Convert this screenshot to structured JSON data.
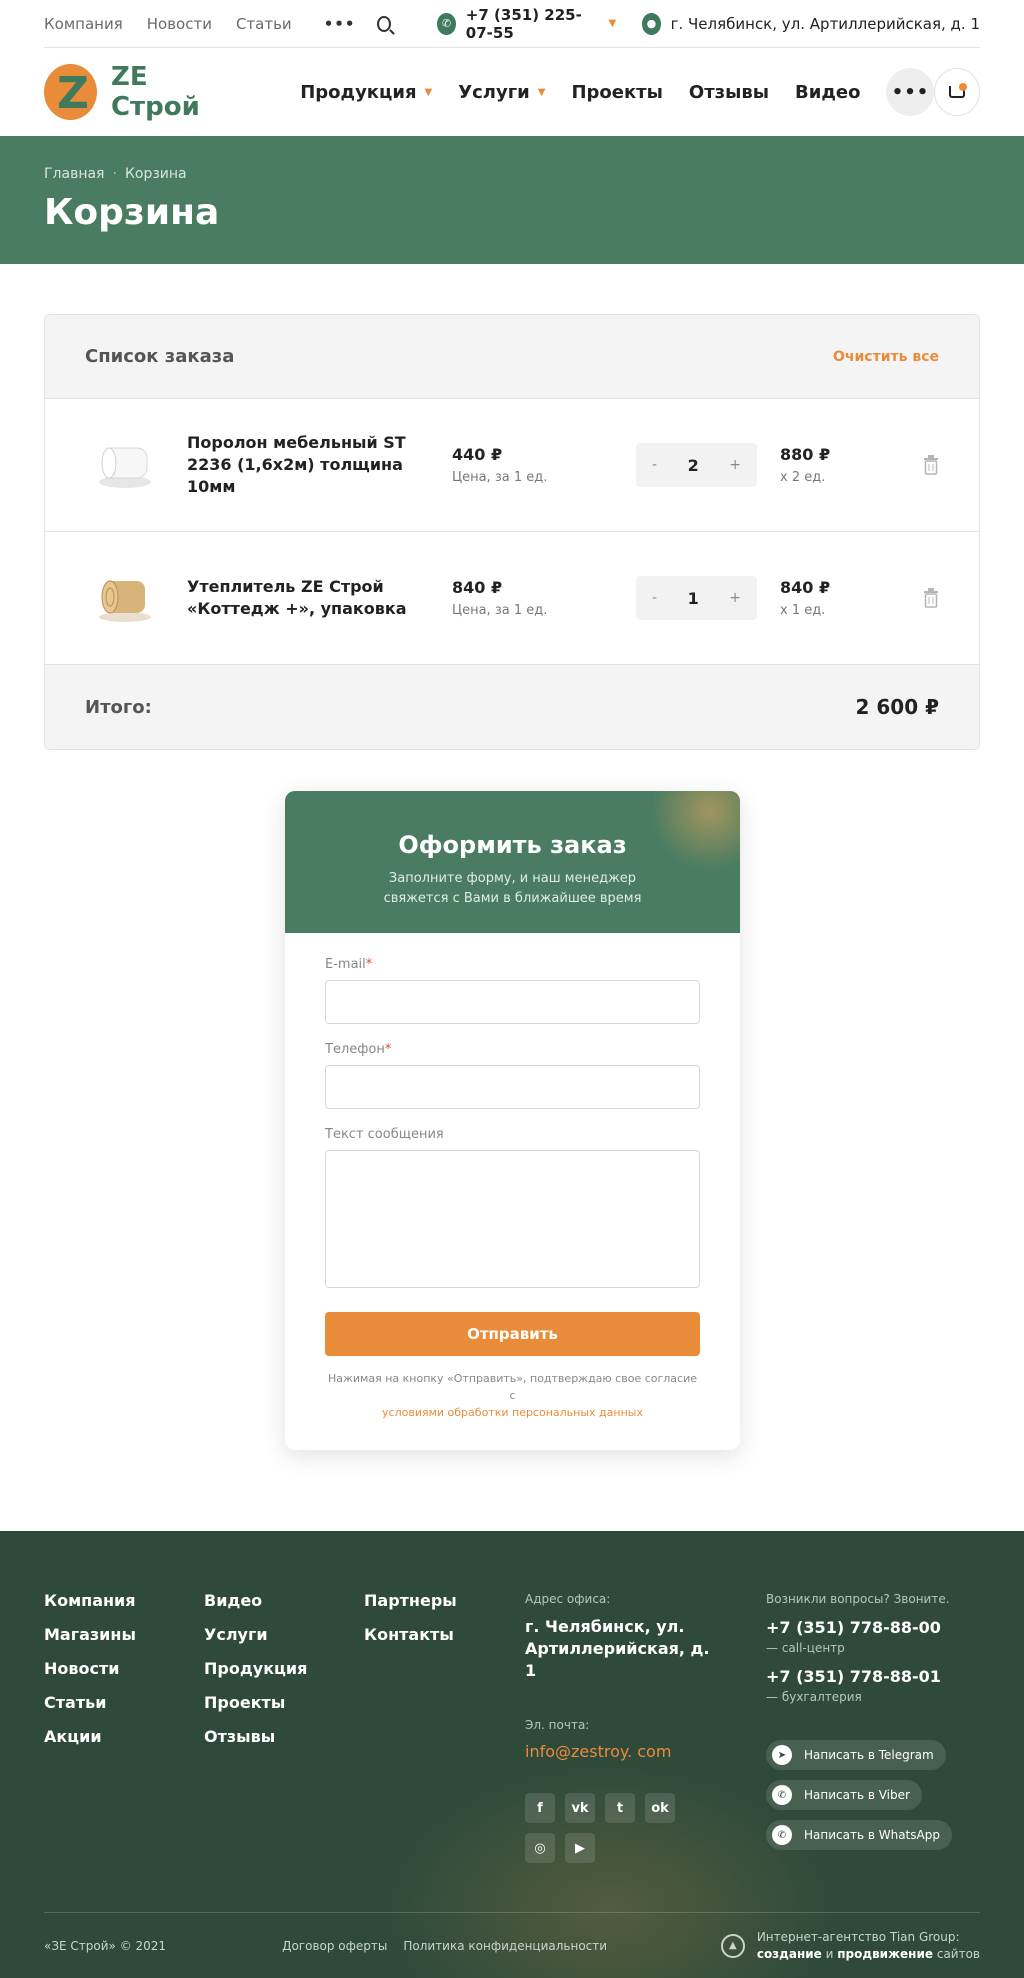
{
  "topbar": {
    "links": [
      "Компания",
      "Новости",
      "Статьи"
    ],
    "more": "•••",
    "phone": "+7 (351) 225-07-55",
    "address": "г. Челябинск, ул. Артиллерийская, д. 1"
  },
  "header": {
    "logo_letter": "Z",
    "logo_text": "ZE Строй",
    "nav": [
      {
        "label": "Продукция",
        "has_caret": true
      },
      {
        "label": "Услуги",
        "has_caret": true
      },
      {
        "label": "Проекты",
        "has_caret": false
      },
      {
        "label": "Отзывы",
        "has_caret": false
      },
      {
        "label": "Видео",
        "has_caret": false
      }
    ],
    "more": "•••"
  },
  "hero": {
    "breadcrumbs": [
      "Главная",
      "Корзина"
    ],
    "title": "Корзина"
  },
  "cart": {
    "title": "Список заказа",
    "clear_label": "Очистить все",
    "items": [
      {
        "name": "Поролон мебельный ST 2236 (1,6х2м) толщина 10мм",
        "price": "440 ₽",
        "price_note": "Цена, за 1 ед.",
        "qty": "2",
        "sum": "880 ₽",
        "sum_note": "x 2 ед.",
        "minus": "-",
        "plus": "+"
      },
      {
        "name": "Утеплитель ZE Строй «Коттедж +», упаковка",
        "price": "840 ₽",
        "price_note": "Цена, за 1 ед.",
        "qty": "1",
        "sum": "840 ₽",
        "sum_note": "x 1 ед.",
        "minus": "-",
        "plus": "+"
      }
    ],
    "total_label": "Итого:",
    "total_value": "2 600 ₽"
  },
  "order_form": {
    "title": "Оформить заказ",
    "subtitle_line1": "Заполните форму, и наш менеджер",
    "subtitle_line2": "свяжется с Вами в ближайшее время",
    "email_label": "E-mail",
    "phone_label": "Телефон",
    "message_label": "Текст сообщения",
    "required_mark": "*",
    "submit_label": "Отправить",
    "agree_text": "Нажимая на кнопку «Отправить», подтверждаю свое согласие с",
    "agree_link": "условиями обработки персональных данных"
  },
  "footer": {
    "col1": [
      "Компания",
      "Магазины",
      "Новости",
      "Статьи",
      "Акции"
    ],
    "col2": [
      "Видео",
      "Услуги",
      "Продукция",
      "Проекты",
      "Отзывы"
    ],
    "col3": [
      "Партнеры",
      "Контакты"
    ],
    "address_caption": "Адрес офиса:",
    "address_line1": "г. Челябинск, ул.",
    "address_line2": "Артиллерийская, д. 1",
    "email_caption": "Эл. почта:",
    "email": "info@zestroy. com",
    "socials": [
      "f",
      "vk",
      "tw",
      "ok",
      "ig",
      "yt"
    ],
    "call_caption": "Возникли вопросы? Звоните.",
    "phone1": "+7 (351) 778-88-00",
    "phone1_note": "— call-центр",
    "phone2": "+7 (351) 778-88-01",
    "phone2_note": "— бухгалтерия",
    "messengers": [
      "Написать в Telegram",
      "Написать в Viber",
      "Написать в WhatsApp"
    ],
    "copyright": "«ЗЕ Строй» © 2021",
    "offer": "Договор оферты",
    "privacy": "Политика конфиденциальности",
    "agency_line1": "Интернет-агентство Tian Group:",
    "agency_w1": "создание",
    "agency_w2": "и",
    "agency_w3": "продвижение",
    "agency_w4": "сайтов"
  },
  "colors": {
    "accent": "#e98c3a",
    "brand_green": "#4a7c62",
    "footer_bg": "#2f4a3a"
  },
  "icons": [
    "search-icon",
    "phone-icon",
    "location-icon",
    "cart-icon",
    "trash-icon",
    "telegram-icon",
    "viber-icon",
    "whatsapp-icon"
  ]
}
